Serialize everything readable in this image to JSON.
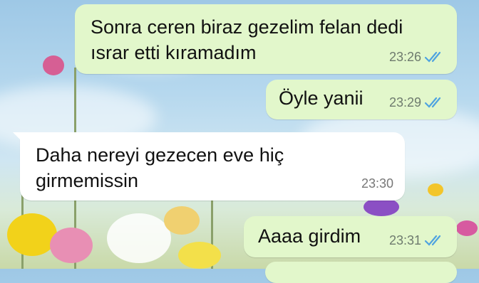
{
  "messages": [
    {
      "direction": "outgoing",
      "text": "Sonra ceren biraz gezelim felan dedi\nısrar etti kıramadım",
      "time": "23:26",
      "read": true
    },
    {
      "direction": "outgoing",
      "text": "Öyle yanii",
      "time": "23:29",
      "read": true
    },
    {
      "direction": "incoming",
      "text": "Daha nereyi gezecen eve hiç\ngirmemissin",
      "time": "23:30"
    },
    {
      "direction": "outgoing",
      "text": "Aaaa girdim",
      "time": "23:31",
      "read": true
    }
  ],
  "colors": {
    "outgoing_bubble": "#e2f7cb",
    "incoming_bubble": "#ffffff",
    "read_ticks": "#4fa3e0"
  },
  "icons": {
    "read_receipt": "double-check-icon"
  }
}
